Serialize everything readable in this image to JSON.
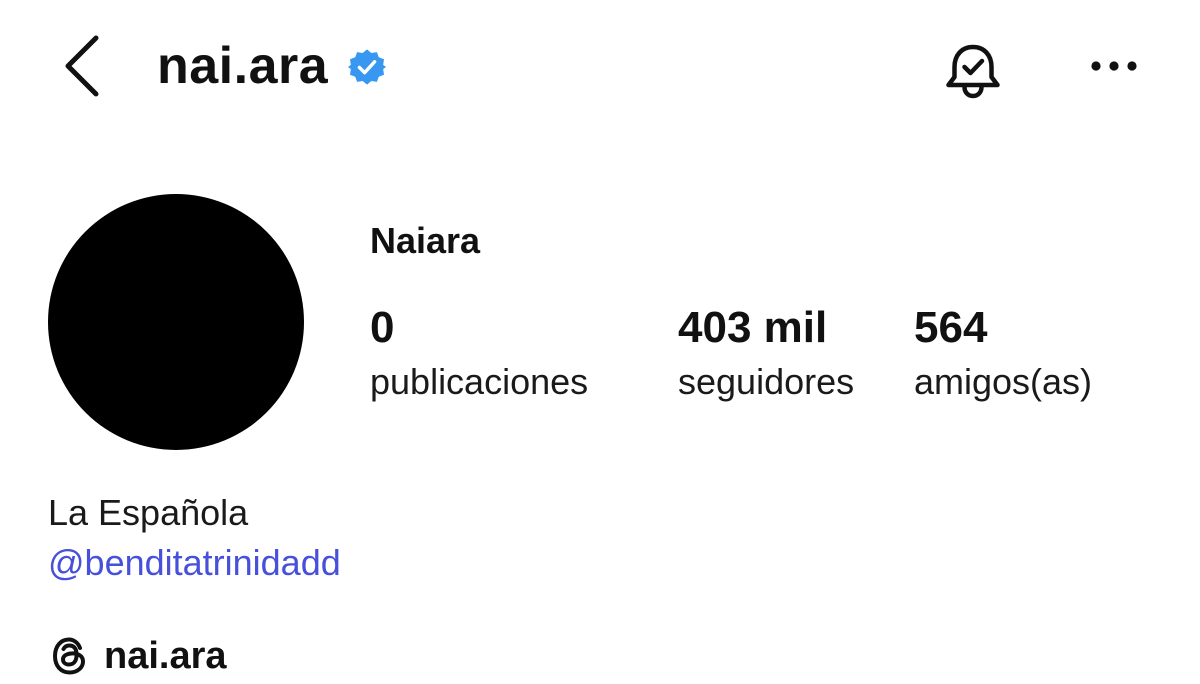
{
  "header": {
    "username": "nai.ara",
    "back_icon": "chevron-left-icon",
    "verified_icon": "verified-badge-icon",
    "notifications_icon": "bell-check-icon",
    "more_icon": "more-horizontal-icon"
  },
  "profile": {
    "display_name": "Naiara",
    "stats": [
      {
        "value": "0",
        "label": "publicaciones"
      },
      {
        "value": "403 mil",
        "label": "seguidores"
      },
      {
        "value": "564",
        "label": "amigos(as)"
      }
    ],
    "bio": "La Española",
    "mention": "@benditatrinidadd",
    "threads_handle": "nai.ara",
    "threads_icon": "threads-icon"
  },
  "colors": {
    "text": "#111111",
    "verified_blue": "#3897f0",
    "link_blue": "#4650d8",
    "avatar": "#000000",
    "background": "#ffffff"
  }
}
